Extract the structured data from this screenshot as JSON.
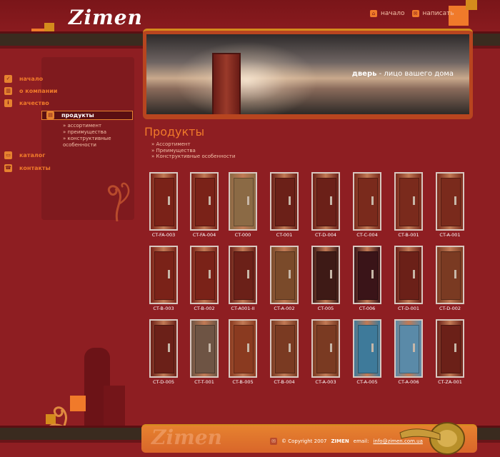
{
  "header": {
    "logo": "Zimen",
    "nav": [
      {
        "label": "начало",
        "icon": "home-icon"
      },
      {
        "label": "написать",
        "icon": "mail-icon"
      }
    ]
  },
  "banner": {
    "slogan_bold": "дверь",
    "slogan_rest": " - лицо вашего дома"
  },
  "sidebar": {
    "items": [
      {
        "label": "начало",
        "icon": "check-icon"
      },
      {
        "label": "о компании",
        "icon": "chart-icon"
      },
      {
        "label": "качество",
        "icon": "info-icon"
      },
      {
        "label": "продукты",
        "icon": "products-icon",
        "active": true
      },
      {
        "label": "каталог",
        "icon": "catalog-icon"
      },
      {
        "label": "контакты",
        "icon": "phone-icon"
      }
    ],
    "subitems": [
      "» ассортимент",
      "» преимущества",
      "» конструктивные особенности"
    ]
  },
  "content": {
    "title": "Продукты",
    "links": [
      "» Ассортимент",
      "» Преимущества",
      "» Конструктивные особенности"
    ]
  },
  "doors": [
    {
      "code": "CT-FA-003",
      "color": "#7a2218"
    },
    {
      "code": "CT-FA-004",
      "color": "#7a2218"
    },
    {
      "code": "CT-000",
      "color": "#8b6a45"
    },
    {
      "code": "CT-001",
      "color": "#6b2018"
    },
    {
      "code": "CT-D-004",
      "color": "#6b2018"
    },
    {
      "code": "CT-C-004",
      "color": "#7a2a1c"
    },
    {
      "code": "CT-B-001",
      "color": "#7a2a1c"
    },
    {
      "code": "CT-A-001",
      "color": "#7a2a1c"
    },
    {
      "code": "CT-B-003",
      "color": "#7a2218"
    },
    {
      "code": "CT-B-002",
      "color": "#7a2218"
    },
    {
      "code": "CT-A001-II",
      "color": "#6b2018"
    },
    {
      "code": "CT-A-002",
      "color": "#7a4a2a"
    },
    {
      "code": "CT-005",
      "color": "#3e1a16"
    },
    {
      "code": "CT-006",
      "color": "#3a1418"
    },
    {
      "code": "CT-D-001",
      "color": "#6b2018"
    },
    {
      "code": "CT-D-002",
      "color": "#7a3a22"
    },
    {
      "code": "CT-D-005",
      "color": "#6b2018"
    },
    {
      "code": "CT-T-001",
      "color": "#6e5444"
    },
    {
      "code": "CT-B-005",
      "color": "#8a3a20"
    },
    {
      "code": "CT-B-004",
      "color": "#7a3a22"
    },
    {
      "code": "CT-A-003",
      "color": "#7a3a22"
    },
    {
      "code": "CT-A-005",
      "color": "#3e7a9a"
    },
    {
      "code": "CT-A-006",
      "color": "#5a8aa8"
    },
    {
      "code": "CT-ZA-001",
      "color": "#6b2018"
    }
  ],
  "footer": {
    "logo": "Zimen",
    "copyright_prefix": "© Copyright 2007",
    "brand": "ZIMEN",
    "email_label": "email:",
    "email": "info@zimen.com.ua"
  },
  "colors": {
    "background": "#8e1e22",
    "accent": "#f07a2a",
    "sidebar": "#7f1a1e"
  }
}
